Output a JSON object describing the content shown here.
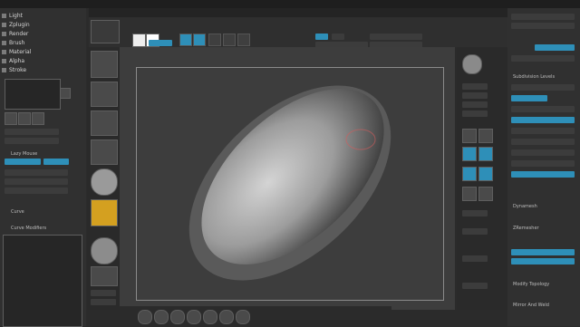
{
  "left_tray": {
    "items": [
      "Light",
      "Zplugin",
      "Render",
      "Brush",
      "Material",
      "Alpha",
      "Stroke"
    ],
    "section_labels": [
      "Lazy Mouse",
      "Curve",
      "Curve Modifiers"
    ]
  },
  "right_panel": {
    "sections": [
      "Subdivision Levels",
      "Dynamesh",
      "ZRemesher",
      "Modify Topology",
      "Mirror And Weld"
    ]
  },
  "colors": {
    "accent": "#2e8fb8",
    "clay": "#9c9c9c"
  }
}
